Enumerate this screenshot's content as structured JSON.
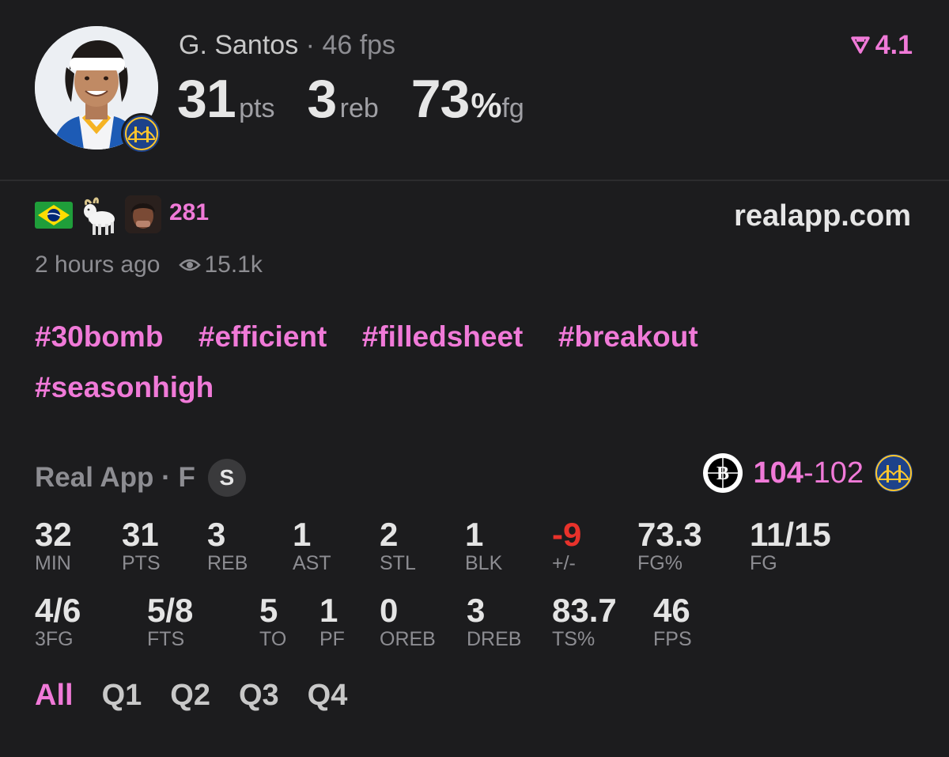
{
  "header": {
    "player_name": "G. Santos",
    "separator": "·",
    "fps_label": "46 fps",
    "pts_value": "31",
    "pts_unit": "pts",
    "reb_value": "3",
    "reb_unit": "reb",
    "fg_value": "73",
    "fg_pct_sign": "%",
    "fg_unit": "fg",
    "rating": "4.1",
    "rating_icon": "real-rating-icon"
  },
  "reactions": {
    "icons": [
      "brazil-flag-icon",
      "goat-icon",
      "reaction-face-icon"
    ],
    "count": "281"
  },
  "site": "realapp.com",
  "meta": {
    "time_ago": "2 hours ago",
    "views": "15.1k"
  },
  "hashtags": [
    "#30bomb",
    "#efficient",
    "#filledsheet",
    "#breakout",
    "#seasonhigh"
  ],
  "game": {
    "source": "Real App · F",
    "badge": "S",
    "score_win": "104",
    "score_dash": "-",
    "score_lose": "102"
  },
  "stats_row1": [
    {
      "value": "32",
      "label": "MIN"
    },
    {
      "value": "31",
      "label": "PTS"
    },
    {
      "value": "3",
      "label": "REB"
    },
    {
      "value": "1",
      "label": "AST"
    },
    {
      "value": "2",
      "label": "STL"
    },
    {
      "value": "1",
      "label": "BLK"
    },
    {
      "value": "-9",
      "label": "+/-"
    },
    {
      "value": "73.3",
      "label": "FG%"
    },
    {
      "value": "11/15",
      "label": "FG"
    }
  ],
  "stats_row2": [
    {
      "value": "4/6",
      "label": "3FG"
    },
    {
      "value": "5/8",
      "label": "FTS"
    },
    {
      "value": "5",
      "label": "TO"
    },
    {
      "value": "1",
      "label": "PF"
    },
    {
      "value": "0",
      "label": "OREB"
    },
    {
      "value": "3",
      "label": "DREB"
    },
    {
      "value": "83.7",
      "label": "TS%"
    },
    {
      "value": "46",
      "label": "FPS"
    }
  ],
  "quarter_tabs": [
    "All",
    "Q1",
    "Q2",
    "Q3",
    "Q4"
  ],
  "colors": {
    "accent": "#f07ad8",
    "negative": "#e8322b",
    "background": "#1c1c1e"
  }
}
